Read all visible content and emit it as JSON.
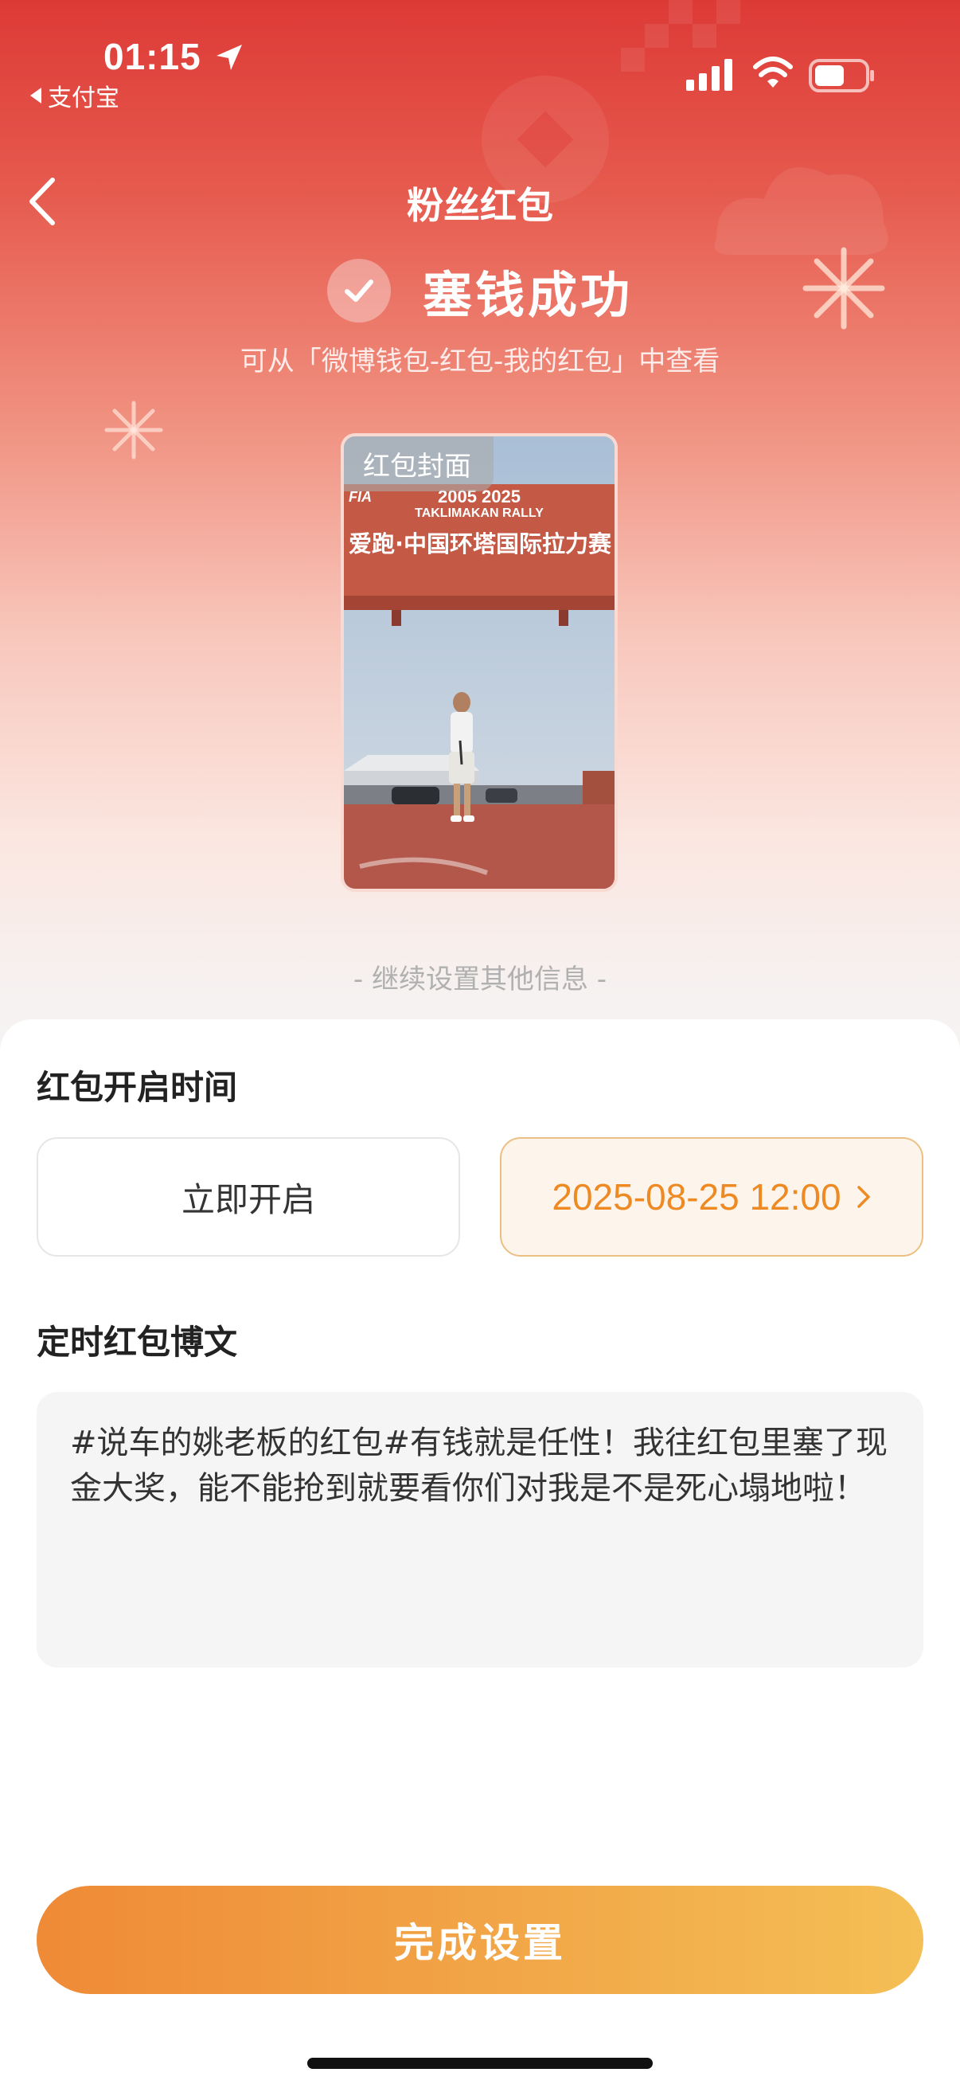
{
  "status_bar": {
    "time": "01:15",
    "back_app": "支付宝"
  },
  "nav": {
    "title": "粉丝红包"
  },
  "success": {
    "title": "塞钱成功",
    "hint": "可从「微博钱包-红包-我的红包」中查看"
  },
  "cover": {
    "tag": "红包封面",
    "banner_line1": "2005 2025",
    "banner_line2": "TAKLIMAKAN RALLY",
    "banner_line3": "爱跑·中国环塔国际拉力赛",
    "fia": "FIA"
  },
  "continue_label": "- 继续设置其他信息 -",
  "open_time": {
    "title": "红包开启时间",
    "option_now": "立即开启",
    "option_time": "2025-08-25 12:00",
    "selected": "option_time"
  },
  "post": {
    "title": "定时红包博文",
    "text": "#说车的姚老板的红包#有钱就是任性！我往红包里塞了现金大奖，能不能抢到就要看你们对我是不是死心塌地啦！"
  },
  "finish_button": "完成设置",
  "colors": {
    "accent": "#ee8a24",
    "hero_red": "#dd3a36",
    "button_start": "#ef8a37",
    "button_end": "#f4bf55"
  }
}
